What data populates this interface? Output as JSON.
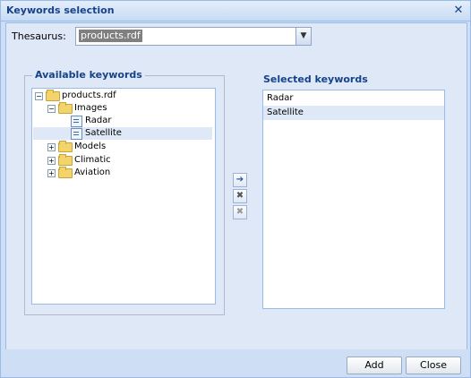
{
  "window": {
    "title": "Keywords selection",
    "close_glyph": "✕"
  },
  "thesaurus": {
    "label": "Thesaurus:",
    "value": "products.rdf",
    "arrow": "▼"
  },
  "available": {
    "legend": "Available keywords",
    "tree": {
      "root": "products.rdf",
      "images": "Images",
      "radar": "Radar",
      "satellite": "Satellite",
      "models": "Models",
      "climatic": "Climatic",
      "aviation": "Aviation"
    },
    "toggles": {
      "collapse": "−",
      "expand": "+"
    }
  },
  "middle": {
    "add_glyph": "➔",
    "remove_glyph": "✖",
    "remove_all_glyph": "✖"
  },
  "selected": {
    "title": "Selected keywords",
    "items": [
      "Radar",
      "Satellite"
    ]
  },
  "footer": {
    "add_label": "Add",
    "close_label": "Close"
  }
}
